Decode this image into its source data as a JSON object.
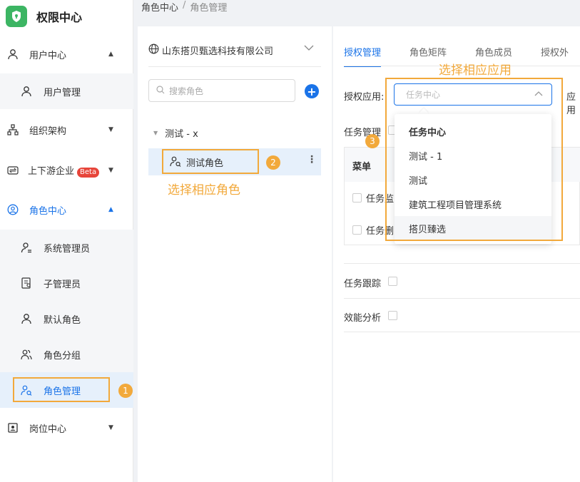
{
  "app": {
    "title": "权限中心"
  },
  "sidebar": {
    "items": [
      {
        "label": "用户中心",
        "arrow": "▲"
      },
      {
        "label": "用户管理"
      },
      {
        "label": "组织架构",
        "arrow": "▼"
      },
      {
        "label": "上下游企业",
        "badge": "Beta",
        "arrow": "▼"
      },
      {
        "label": "角色中心",
        "arrow": "▲"
      },
      {
        "label": "系统管理员"
      },
      {
        "label": "子管理员"
      },
      {
        "label": "默认角色"
      },
      {
        "label": "角色分组"
      },
      {
        "label": "角色管理"
      },
      {
        "label": "岗位中心",
        "arrow": "▼"
      }
    ]
  },
  "breadcrumb": {
    "parent": "角色中心",
    "separator": "/",
    "current": "角色管理"
  },
  "middle": {
    "company": "山东搭贝甄选科技有限公司",
    "search_placeholder": "搜索角色",
    "add_symbol": "+",
    "group": "测试 - x",
    "node": "测试角色",
    "more_symbol": "⋮"
  },
  "tabs": [
    "授权管理",
    "角色矩阵",
    "角色成员",
    "授权外"
  ],
  "right": {
    "app_label": "授权应用:",
    "app_label_right": "应用",
    "select_value": "任务中心",
    "task_manage": "任务管理",
    "table_header": "菜单",
    "row1": "任务监",
    "row2": "任务删",
    "track": "任务跟踪",
    "efficiency": "效能分析"
  },
  "dropdown": {
    "options": [
      "任务中心",
      "测试 - 1",
      "测试",
      "建筑工程项目管理系统",
      "搭贝臻选"
    ]
  },
  "annotations": {
    "step1": "1",
    "step2": "2",
    "step3": "3",
    "hint_role": "选择相应角色",
    "hint_app": "选择相应应用"
  },
  "colors": {
    "accent": "#1a73e8",
    "highlight": "#f2a93b",
    "brand": "#3cb563",
    "beta": "#e7453a"
  }
}
